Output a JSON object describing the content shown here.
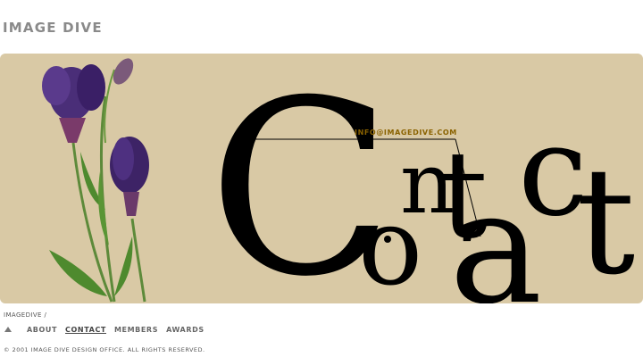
{
  "header": {
    "logo_text": "IMAGE DIVE"
  },
  "hero": {
    "background": "#d9c9a5",
    "email": "INFO@IMAGEDIVE.COM",
    "artwork_letters": [
      "C",
      "o",
      "n",
      "t",
      "a",
      "c",
      "t"
    ]
  },
  "breadcrumb": "IMAGEDIVE /",
  "nav": {
    "up_icon": "up-triangle-icon",
    "items": [
      {
        "label": "ABOUT",
        "active": false
      },
      {
        "label": "CONTACT",
        "active": true
      },
      {
        "label": "MEMBERS",
        "active": false
      },
      {
        "label": "AWARDS",
        "active": false
      }
    ]
  },
  "footer": {
    "copyright": "© 2001 IMAGE DIVE DESIGN OFFICE. ALL RIGHTS RESERVED."
  }
}
